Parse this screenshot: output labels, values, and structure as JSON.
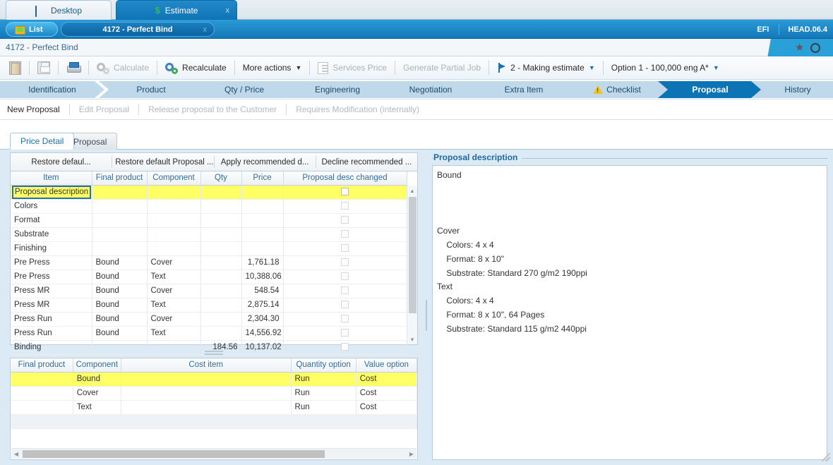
{
  "app_tabs": [
    {
      "label": "Desktop",
      "icon": "monitor-icon",
      "active": false
    },
    {
      "label": "Estimate",
      "icon": "money-icon",
      "active": true,
      "close": "x"
    }
  ],
  "header": {
    "list_button": "List",
    "document_title": "4172 - Perfect Bind",
    "document_close": "x",
    "brand": "EFI",
    "version": "HEAD.06.4"
  },
  "breadcrumb": {
    "text": "4172 - Perfect Bind",
    "star_icon": "star-icon",
    "globe_icon": "globe-icon"
  },
  "toolbar": {
    "exit_label": "",
    "save_label": "",
    "print_label": "",
    "calculate_label": "Calculate",
    "recalculate_label": "Recalculate",
    "more_actions_label": "More actions",
    "services_price_label": "Services Price",
    "generate_partial_job_label": "Generate Partial Job",
    "status_label": "2 - Making estimate",
    "option_label": "Option 1 - 100,000 eng A*",
    "caret": "▼"
  },
  "stages": [
    {
      "label": "Identification",
      "selected": false
    },
    {
      "label": "Product",
      "selected": false
    },
    {
      "label": "Qty / Price",
      "selected": false
    },
    {
      "label": "Engineering",
      "selected": false
    },
    {
      "label": "Negotiation",
      "selected": false
    },
    {
      "label": "Extra Item",
      "selected": false
    },
    {
      "label": "Checklist",
      "selected": false,
      "icon": "warning-icon"
    },
    {
      "label": "Proposal",
      "selected": true
    },
    {
      "label": "History",
      "selected": false
    }
  ],
  "proposal_actions": [
    {
      "label": "New Proposal",
      "enabled": true
    },
    {
      "label": "Edit Proposal",
      "enabled": false
    },
    {
      "label": "Release proposal to the Customer",
      "enabled": false
    },
    {
      "label": "Requires Modification (internally)",
      "enabled": false
    }
  ],
  "inner_tabs": [
    {
      "label": "Price Detail",
      "selected": true
    },
    {
      "label": "Proposal",
      "selected": false
    }
  ],
  "grid_buttons": [
    "Restore defaul...",
    "Restore default Proposal ...",
    "Apply recommended d...",
    "Decline recommended ..."
  ],
  "price_grid": {
    "columns": [
      "Item",
      "Final product",
      "Component",
      "Qty",
      "Price",
      "Proposal desc changed"
    ],
    "rows": [
      {
        "item": "Proposal description",
        "final_product": "",
        "component": "",
        "qty": "",
        "price": "",
        "changed": false,
        "highlight": true,
        "selected_cell": true
      },
      {
        "item": "Colors",
        "final_product": "",
        "component": "",
        "qty": "",
        "price": "",
        "changed": false
      },
      {
        "item": "Format",
        "final_product": "",
        "component": "",
        "qty": "",
        "price": "",
        "changed": false
      },
      {
        "item": "Substrate",
        "final_product": "",
        "component": "",
        "qty": "",
        "price": "",
        "changed": false
      },
      {
        "item": "Finishing",
        "final_product": "",
        "component": "",
        "qty": "",
        "price": "",
        "changed": false
      },
      {
        "item": "Pre Press",
        "final_product": "Bound",
        "component": "Cover",
        "qty": "",
        "price": "1,761.18",
        "changed": false
      },
      {
        "item": "Pre Press",
        "final_product": "Bound",
        "component": "Text",
        "qty": "",
        "price": "10,388.06",
        "changed": false
      },
      {
        "item": "Press MR",
        "final_product": "Bound",
        "component": "Cover",
        "qty": "",
        "price": "548.54",
        "changed": false
      },
      {
        "item": "Press MR",
        "final_product": "Bound",
        "component": "Text",
        "qty": "",
        "price": "2,875.14",
        "changed": false
      },
      {
        "item": "Press Run",
        "final_product": "Bound",
        "component": "Cover",
        "qty": "",
        "price": "2,304.30",
        "changed": false
      },
      {
        "item": "Press Run",
        "final_product": "Bound",
        "component": "Text",
        "qty": "",
        "price": "14,556.92",
        "changed": false
      },
      {
        "item": "Binding",
        "final_product": "",
        "component": "",
        "qty": "184.56",
        "price": "10,137.02",
        "changed": false
      }
    ]
  },
  "cost_grid": {
    "columns": [
      "Final product",
      "Component",
      "Cost item",
      "Quantity option",
      "Value option"
    ],
    "rows": [
      {
        "final_product": "",
        "component": "Bound",
        "cost_item": "",
        "quantity_option": "Run",
        "value_option": "Cost",
        "highlight": true
      },
      {
        "final_product": "",
        "component": "Cover",
        "cost_item": "",
        "quantity_option": "Run",
        "value_option": "Cost",
        "highlight": false
      },
      {
        "final_product": "",
        "component": "Text",
        "cost_item": "",
        "quantity_option": "Run",
        "value_option": "Cost",
        "highlight": false
      }
    ]
  },
  "proposal_panel": {
    "title": "Proposal description",
    "text": "Bound\n\n\n\nCover\n    Colors: 4 x 4\n    Format: 8 x 10\"\n    Substrate: Standard 270 g/m2 190ppi\nText\n    Colors: 4 x 4\n    Format: 8 x 10\", 64 Pages\n    Substrate: Standard 115 g/m2 440ppi"
  },
  "colors": {
    "accent_blue": "#0c73b4",
    "header_blue": "#1578b8",
    "panel_bg": "#dceaf6",
    "highlight_yellow": "#ffff66",
    "stage_bg": "#bfd9ea",
    "label_blue": "#2f6d9e"
  }
}
